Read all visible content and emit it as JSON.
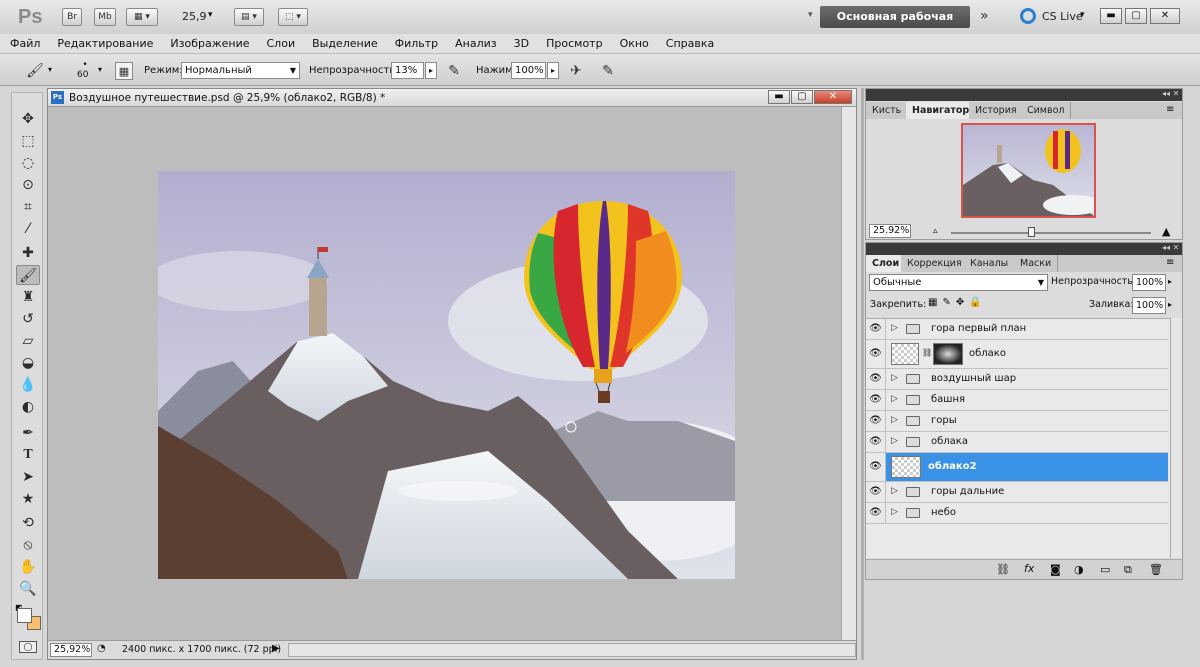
{
  "app": {
    "logo": "Ps",
    "bridge_btn": "Br",
    "minibridge_btn": "Mb",
    "zoom": "25,9",
    "workspace": "Основная рабочая среда",
    "cs_live": "CS Live"
  },
  "menu": [
    "Файл",
    "Редактирование",
    "Изображение",
    "Слои",
    "Выделение",
    "Фильтр",
    "Анализ",
    "3D",
    "Просмотр",
    "Окно",
    "Справка"
  ],
  "options": {
    "brush_size": "60",
    "mode_label": "Режим:",
    "mode_value": "Нормальный",
    "opacity_label": "Непрозрачность:",
    "opacity_value": "13%",
    "flow_label": "Нажим:",
    "flow_value": "100%"
  },
  "document": {
    "title": "Воздушное путешествие.psd @ 25,9% (облако2, RGB/8) *",
    "status_zoom": "25,92%",
    "status_info": "2400 пикс. x 1700 пикс. (72 ppi)"
  },
  "navigator": {
    "tabs": [
      "Кисть",
      "Навигатор",
      "История",
      "Символ"
    ],
    "active": "Навигатор",
    "zoom": "25.92%"
  },
  "layers_panel": {
    "tabs": [
      "Слои",
      "Коррекция",
      "Каналы",
      "Маски"
    ],
    "blend_mode": "Обычные",
    "opacity_label": "Непрозрачность:",
    "opacity_value": "100%",
    "lock_label": "Закрепить:",
    "fill_label": "Заливка:",
    "fill_value": "100%",
    "layers": [
      {
        "name": "гора первый план",
        "type": "group"
      },
      {
        "name": "облако",
        "type": "masked"
      },
      {
        "name": "воздушный шар",
        "type": "group"
      },
      {
        "name": "башня",
        "type": "group"
      },
      {
        "name": "горы",
        "type": "group"
      },
      {
        "name": "облака",
        "type": "group"
      },
      {
        "name": "облако2",
        "type": "layer",
        "selected": true
      },
      {
        "name": "горы дальние",
        "type": "group"
      },
      {
        "name": "небо",
        "type": "group"
      }
    ]
  },
  "colors": {
    "selection": "#3a92e6",
    "background_swatch": "#f6c070"
  }
}
